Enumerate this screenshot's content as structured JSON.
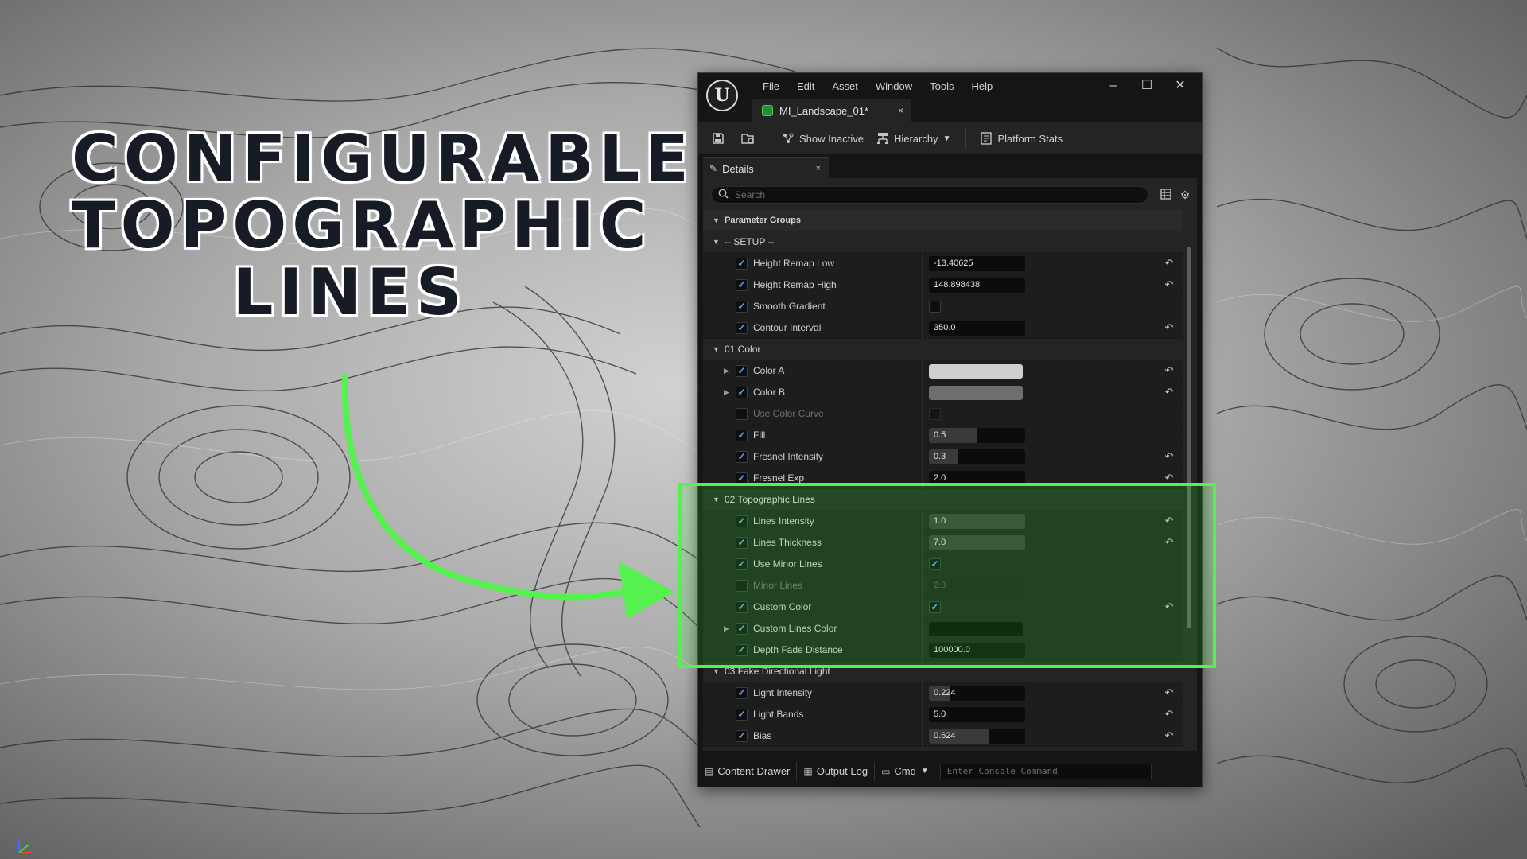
{
  "headline": {
    "line1": "CONFIGURABLE",
    "line2": "TOPOGRAPHIC",
    "line3": "LINES"
  },
  "window": {
    "menu": [
      "File",
      "Edit",
      "Asset",
      "Window",
      "Tools",
      "Help"
    ],
    "controls": {
      "minimize": "–",
      "maximize": "☐",
      "close": "✕"
    },
    "doc_tab": {
      "title": "MI_Landscape_01*",
      "close": "×"
    }
  },
  "toolbar": {
    "show_inactive": "Show Inactive",
    "hierarchy": "Hierarchy",
    "platform_stats": "Platform Stats"
  },
  "details": {
    "tab_label": "Details",
    "tab_close": "×",
    "search_placeholder": "Search",
    "category": "Parameter Groups",
    "groups": {
      "setup": {
        "title": "-- SETUP --",
        "height_remap_low": {
          "label": "Height Remap Low",
          "value": "-13.40625"
        },
        "height_remap_high": {
          "label": "Height Remap High",
          "value": "148.898438"
        },
        "smooth_gradient": {
          "label": "Smooth Gradient"
        },
        "contour_interval": {
          "label": "Contour Interval",
          "value": "350.0"
        }
      },
      "color": {
        "title": "01 Color",
        "color_a": {
          "label": "Color A",
          "swatch": "#cfcfcf"
        },
        "color_b": {
          "label": "Color B",
          "swatch": "#6e6e6e"
        },
        "use_color_curve": {
          "label": "Use Color Curve"
        },
        "fill": {
          "label": "Fill",
          "value": "0.5",
          "level": 0.5
        },
        "fresnel_intensity": {
          "label": "Fresnel Intensity",
          "value": "0.3",
          "level": 0.3
        },
        "fresnel_exp": {
          "label": "Fresnel Exp",
          "value": "2.0"
        }
      },
      "topo": {
        "title": "02 Topographic Lines",
        "lines_intensity": {
          "label": "Lines Intensity",
          "value": "1.0"
        },
        "lines_thickness": {
          "label": "Lines Thickness",
          "value": "7.0"
        },
        "use_minor_lines": {
          "label": "Use Minor Lines"
        },
        "minor_lines": {
          "label": "Minor Lines",
          "value": "2.0"
        },
        "custom_color": {
          "label": "Custom Color"
        },
        "custom_lines_color": {
          "label": "Custom Lines Color",
          "swatch": "#050505"
        },
        "depth_fade_distance": {
          "label": "Depth Fade Distance",
          "value": "100000.0"
        }
      },
      "light": {
        "title": "03 Fake Directional Light",
        "light_intensity": {
          "label": "Light Intensity",
          "value": "0.224",
          "level": 0.224
        },
        "light_bands": {
          "label": "Light Bands",
          "value": "5.0"
        },
        "bias": {
          "label": "Bias",
          "value": "0.624",
          "level": 0.624
        }
      }
    }
  },
  "statusbar": {
    "content_drawer": "Content Drawer",
    "output_log": "Output Log",
    "cmd": "Cmd",
    "console_placeholder": "Enter Console Command"
  },
  "colors": {
    "highlight": "#55f24f",
    "accent_check": "#5fa8ff"
  }
}
